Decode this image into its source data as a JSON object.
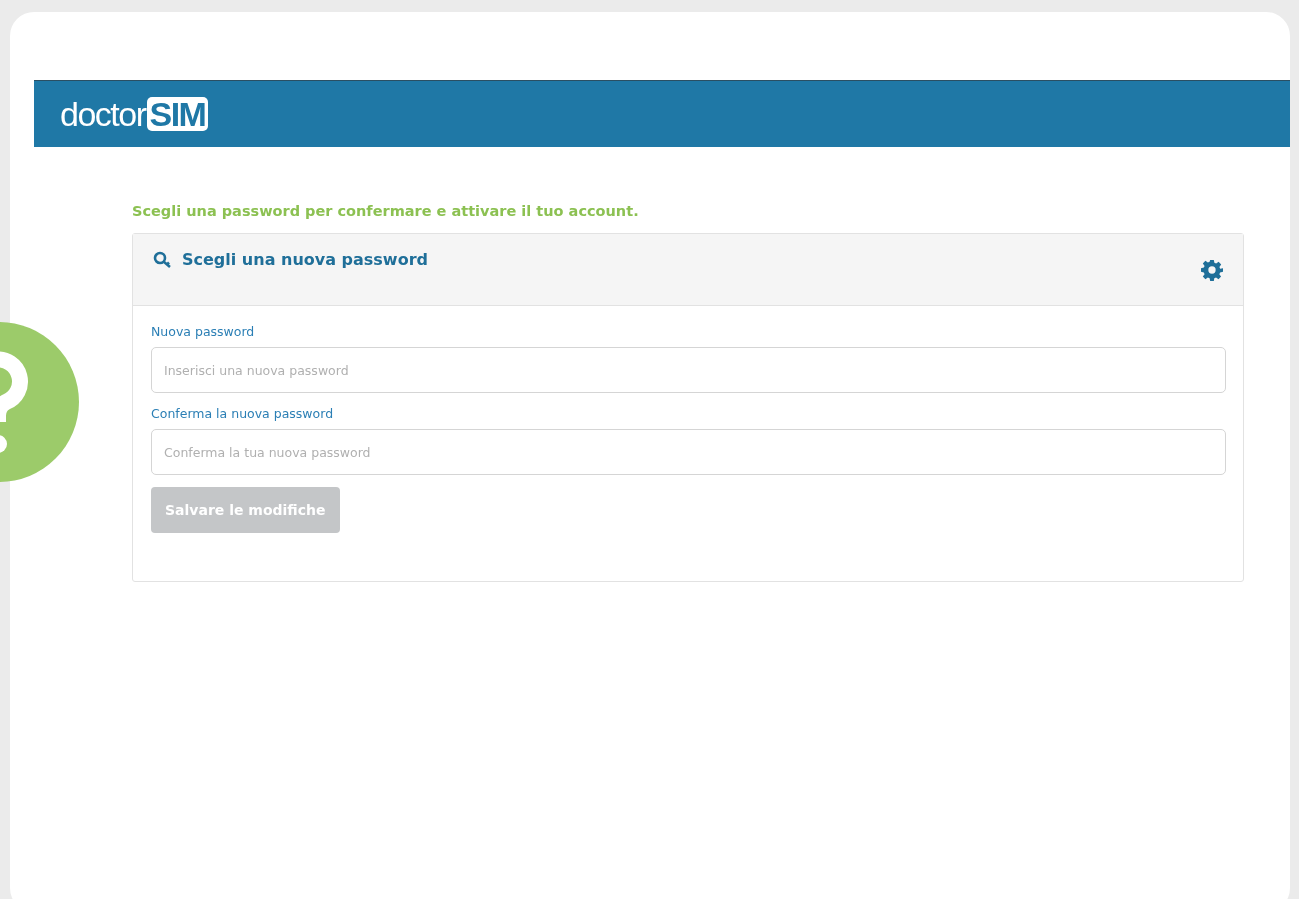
{
  "header": {
    "logo": {
      "text": "doctor",
      "badge": "SIM"
    }
  },
  "instruction": "Scegli una password per confermare e attivare il tuo account.",
  "panel": {
    "title": "Scegli una nuova password",
    "fields": [
      {
        "label": "Nuova password",
        "placeholder": "Inserisci una nuova password"
      },
      {
        "label": "Conferma la nuova password",
        "placeholder": "Conferma la tua nuova password"
      }
    ],
    "button": {
      "label": "Salvare le modifiche",
      "disabled": true
    }
  }
}
